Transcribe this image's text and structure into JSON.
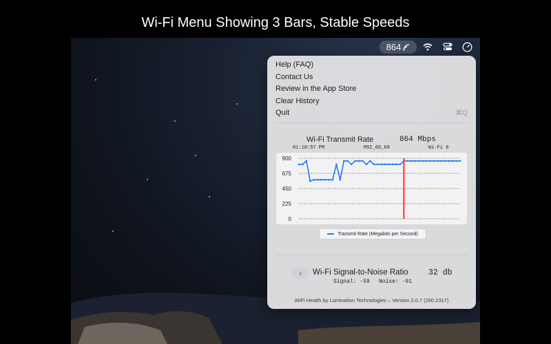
{
  "caption": "Wi-Fi Menu Showing 3 Bars, Stable Speeds",
  "menubar": {
    "rate_value": "864",
    "icons": [
      "wifi-bars-icon",
      "wifi-icon",
      "control-center-icon",
      "clock-icon"
    ]
  },
  "menu": {
    "items": [
      {
        "label": "Help (FAQ)"
      },
      {
        "label": "Contact Us"
      },
      {
        "label": "Review in the App Store"
      },
      {
        "label": "Clear History"
      },
      {
        "label": "Quit",
        "shortcut": "⌘Q"
      }
    ]
  },
  "transmit": {
    "title": "Wi-Fi Transmit Rate",
    "value": "864 Mbps",
    "time": "01:10:57 PM",
    "network": "MSI_6G_60",
    "standard": "Wi-Fi 6"
  },
  "chart_data": {
    "type": "line",
    "ylim": [
      0,
      900
    ],
    "y_ticks": [
      "900",
      "675",
      "450",
      "225",
      "0"
    ],
    "grid": true,
    "legend_position": "bottom",
    "series": [
      {
        "name": "Transmit Rate (Megabits per Second)",
        "color": "#1e7bf0",
        "values": [
          810,
          810,
          860,
          560,
          580,
          580,
          580,
          580,
          580,
          580,
          810,
          580,
          860,
          860,
          810,
          860,
          860,
          860,
          810,
          860,
          810,
          810,
          810,
          810,
          810,
          810,
          810,
          810,
          860,
          860,
          860,
          860,
          860,
          860,
          860,
          860,
          860,
          860,
          860,
          860,
          860,
          860,
          860,
          860
        ]
      }
    ],
    "marker_index": 28,
    "marker_color": "#ff3b30"
  },
  "snr": {
    "title": "Wi-Fi Signal-to-Noise Ratio",
    "value": "32  db",
    "signal": "Signal: -59",
    "noise": "Noise: -91",
    "expand_glyph": "›"
  },
  "footer": "WiFi Health by Lumination Technologies – Version 2.0.7 (260.2317)"
}
